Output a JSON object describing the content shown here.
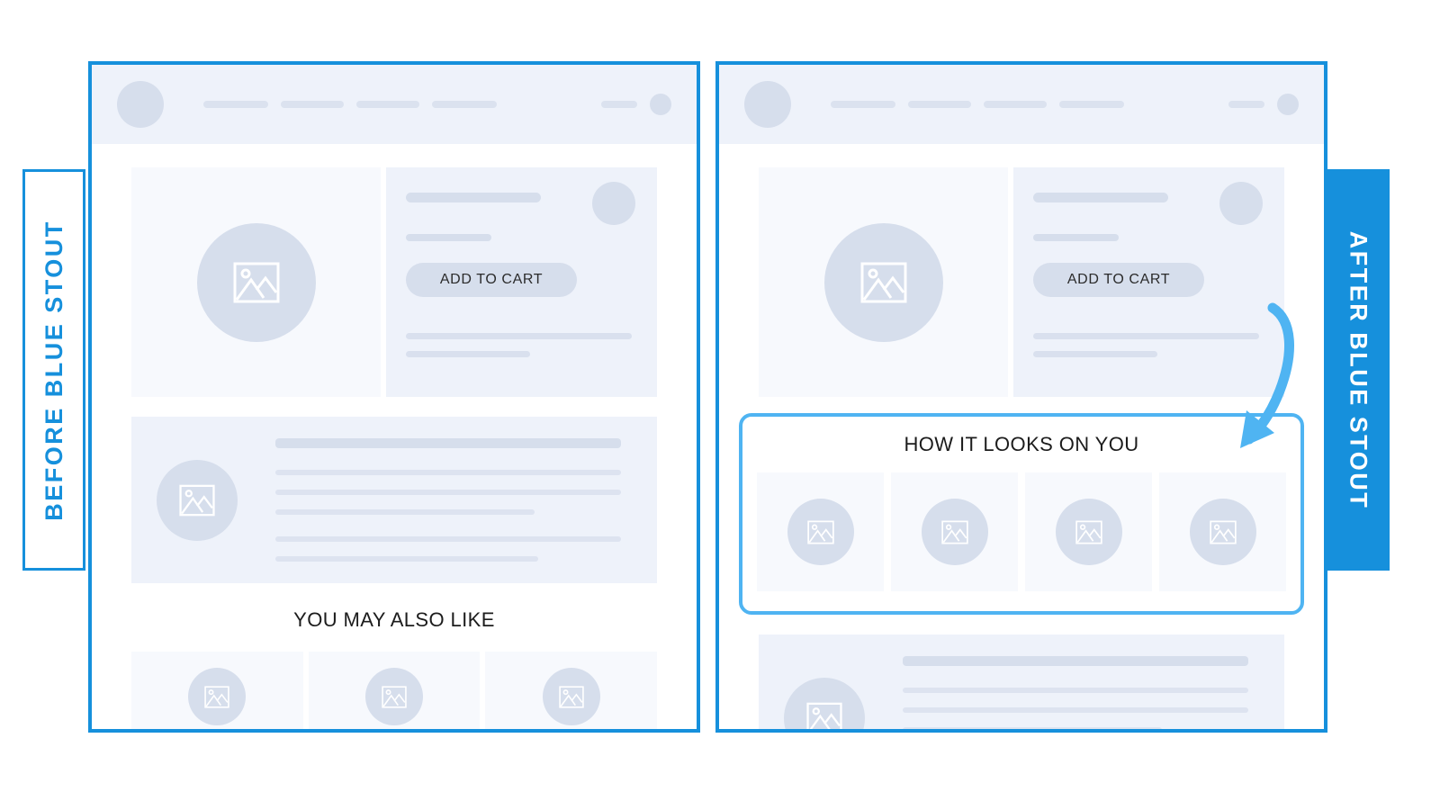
{
  "labels": {
    "before": "BEFORE  BLUE STOUT",
    "after": "AFTER  BLUE STOUT"
  },
  "colors": {
    "brand_blue": "#1690DC",
    "highlight_blue": "#4FB4F2",
    "placeholder": "#D6DEEC",
    "panel_bg": "#EEF2FA",
    "tile_bg": "#F7F9FD"
  },
  "panels": {
    "before": {
      "header": {
        "logo": "logo-placeholder",
        "nav_items": [
          "",
          "",
          "",
          ""
        ],
        "account_bar": "",
        "account_dot": ""
      },
      "product": {
        "image": "product-image-placeholder",
        "title_bar": "",
        "price_bar": "",
        "avatar": "",
        "add_to_cart_label": "ADD TO CART",
        "meta_lines": [
          "",
          ""
        ]
      },
      "description": {
        "thumb": "description-image-placeholder",
        "heading_line": "",
        "body_lines": [
          "",
          "",
          "",
          "",
          ""
        ]
      },
      "recommendations": {
        "title": "YOU MAY ALSO LIKE",
        "cards": [
          "",
          "",
          ""
        ]
      }
    },
    "after": {
      "header": {
        "logo": "logo-placeholder",
        "nav_items": [
          "",
          "",
          "",
          ""
        ],
        "account_bar": "",
        "account_dot": ""
      },
      "product": {
        "image": "product-image-placeholder",
        "title_bar": "",
        "price_bar": "",
        "avatar": "",
        "add_to_cart_label": "ADD TO CART",
        "meta_lines": [
          "",
          ""
        ]
      },
      "ugc_module": {
        "title": "HOW IT LOOKS ON YOU",
        "thumbnails": [
          "",
          "",
          "",
          ""
        ]
      },
      "description": {
        "thumb": "description-image-placeholder",
        "heading_line": "",
        "body_lines": [
          "",
          "",
          "",
          "",
          ""
        ]
      }
    }
  },
  "annotation": {
    "arrow": "curved-arrow-pointing-to-ugc-module"
  }
}
